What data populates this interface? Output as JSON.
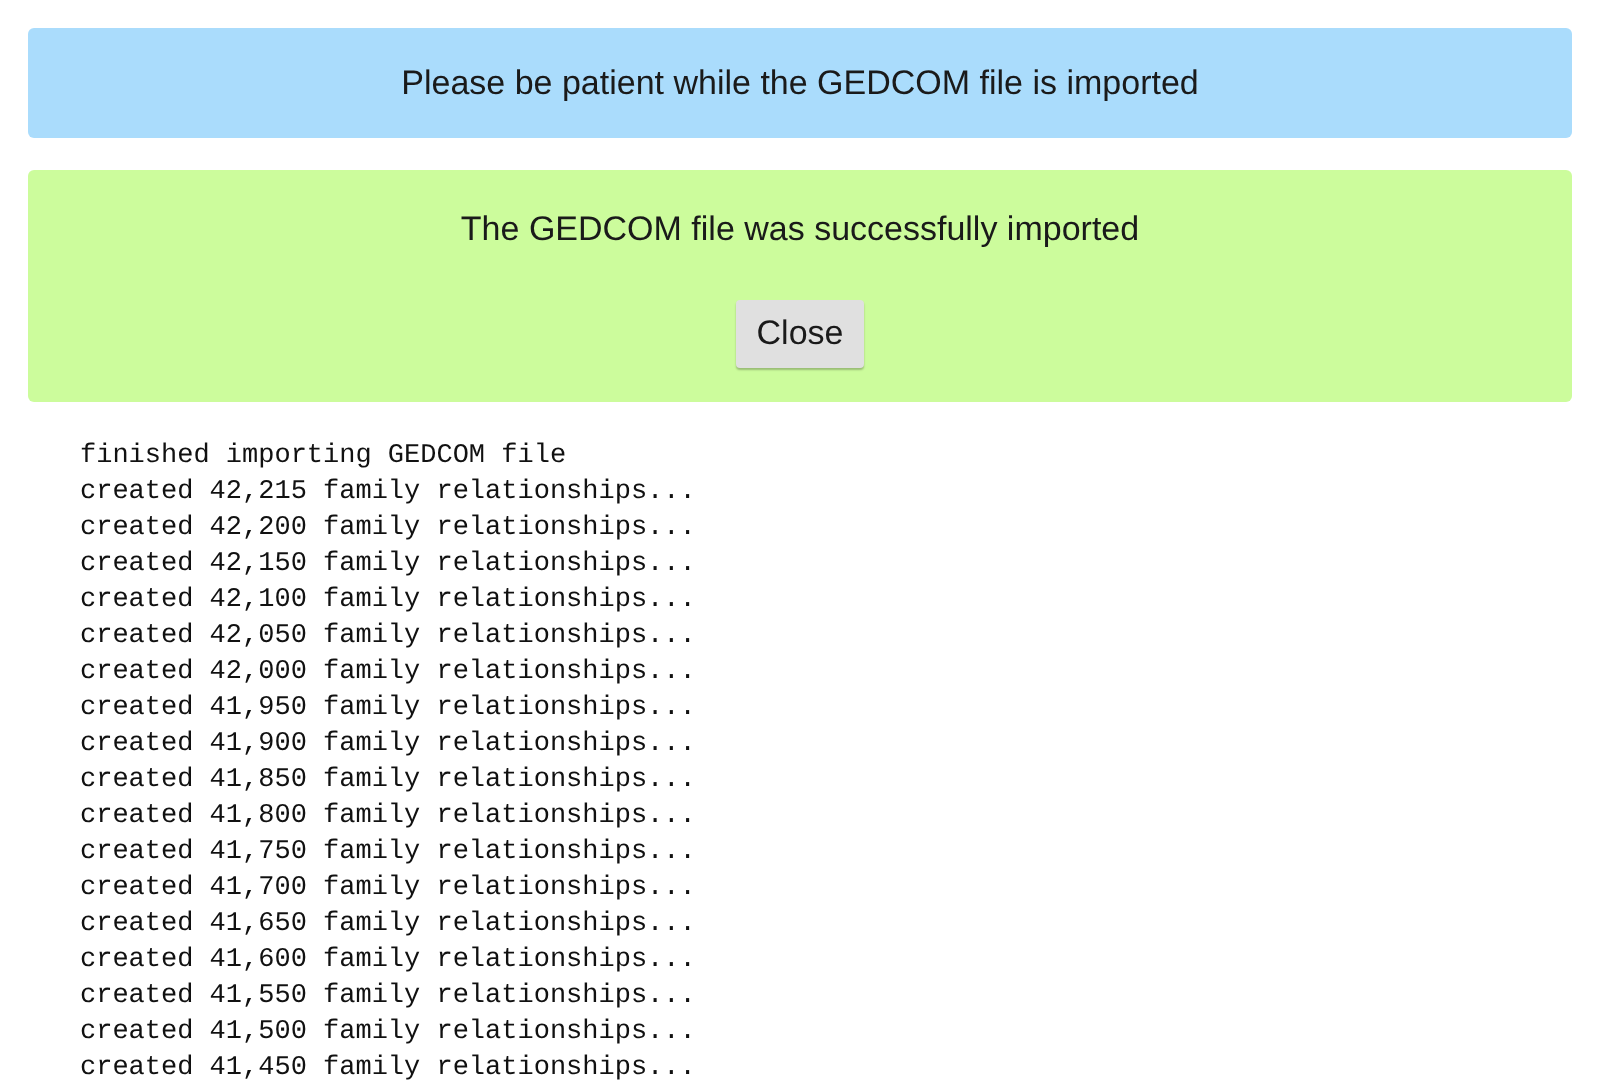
{
  "info_banner": {
    "message": "Please be patient while the GEDCOM file is imported"
  },
  "success_banner": {
    "message": "The GEDCOM file was successfully imported",
    "button": "Close"
  },
  "log_lines": [
    "finished importing GEDCOM file",
    "created 42,215 family relationships...",
    "created 42,200 family relationships...",
    "created 42,150 family relationships...",
    "created 42,100 family relationships...",
    "created 42,050 family relationships...",
    "created 42,000 family relationships...",
    "created 41,950 family relationships...",
    "created 41,900 family relationships...",
    "created 41,850 family relationships...",
    "created 41,800 family relationships...",
    "created 41,750 family relationships...",
    "created 41,700 family relationships...",
    "created 41,650 family relationships...",
    "created 41,600 family relationships...",
    "created 41,550 family relationships...",
    "created 41,500 family relationships...",
    "created 41,450 family relationships..."
  ]
}
